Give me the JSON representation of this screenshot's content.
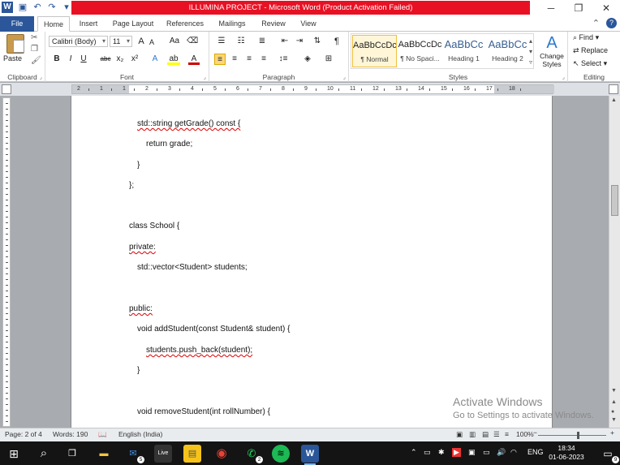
{
  "window": {
    "title": "ILLUMINA PROJECT - Microsoft Word (Product Activation Failed)",
    "app_logo": "W",
    "min": "─",
    "restore": "❐",
    "close": "✕"
  },
  "tabs": [
    "File",
    "Home",
    "Insert",
    "Page Layout",
    "References",
    "Mailings",
    "Review",
    "View"
  ],
  "active_tab": "Home",
  "ribbon": {
    "clipboard": {
      "label": "Clipboard",
      "paste": "Paste"
    },
    "font": {
      "label": "Font",
      "name": "Calibri (Body)",
      "size": "11",
      "grow": "A",
      "shrink": "A",
      "case": "Aa",
      "bold": "B",
      "italic": "I",
      "underline": "U",
      "strike": "abc",
      "sub": "x₂",
      "sup": "x²"
    },
    "paragraph": {
      "label": "Paragraph",
      "pilcrow": "¶"
    },
    "styles": {
      "label": "Styles",
      "items": [
        {
          "preview": "AaBbCcDc",
          "name": "¶ Normal"
        },
        {
          "preview": "AaBbCcDc",
          "name": "¶ No Spaci..."
        },
        {
          "preview": "AaBbCc",
          "name": "Heading 1"
        },
        {
          "preview": "AaBbCc",
          "name": "Heading 2"
        }
      ],
      "change": "Change Styles"
    },
    "editing": {
      "label": "Editing",
      "find": "Find",
      "replace": "Replace",
      "select": "Select"
    }
  },
  "ruler_numbers": [
    "2",
    "1",
    "1",
    "2",
    "3",
    "4",
    "5",
    "6",
    "7",
    "8",
    "9",
    "10",
    "11",
    "12",
    "13",
    "14",
    "15",
    "16",
    "17",
    "18"
  ],
  "document": {
    "lines": [
      "std::string getGrade() const {",
      "return grade;",
      "}",
      "};",
      "class School {",
      "private:",
      "std::vector<Student> students;",
      "public:",
      "void addStudent(const Student& student) {",
      "students.push_back(student);",
      "}",
      "void removeStudent(int rollNumber) {"
    ],
    "watermark_title": "Activate Windows",
    "watermark_sub": "Go to Settings to activate Windows."
  },
  "status": {
    "page": "Page: 2 of 4",
    "words": "Words: 190",
    "language": "English (India)",
    "zoom": "100%",
    "zoom_minus": "−",
    "zoom_plus": "+"
  },
  "taskbar": {
    "apps": [
      {
        "name": "start",
        "glyph": "⊞"
      },
      {
        "name": "search",
        "glyph": "⌕"
      },
      {
        "name": "task-view",
        "glyph": "❐"
      },
      {
        "name": "live",
        "glyph": "Live"
      },
      {
        "name": "file-explorer",
        "glyph": "▬"
      },
      {
        "name": "mail",
        "glyph": "✉",
        "badge": "5"
      },
      {
        "name": "sticky-notes",
        "glyph": "▤"
      },
      {
        "name": "chrome",
        "glyph": "◉"
      },
      {
        "name": "whatsapp",
        "glyph": "✆",
        "badge": "2"
      },
      {
        "name": "spotify",
        "glyph": "≋"
      },
      {
        "name": "word",
        "glyph": "W"
      }
    ],
    "language": "ENG",
    "time": "18:34",
    "date": "01-06-2023",
    "notifications": "9"
  }
}
